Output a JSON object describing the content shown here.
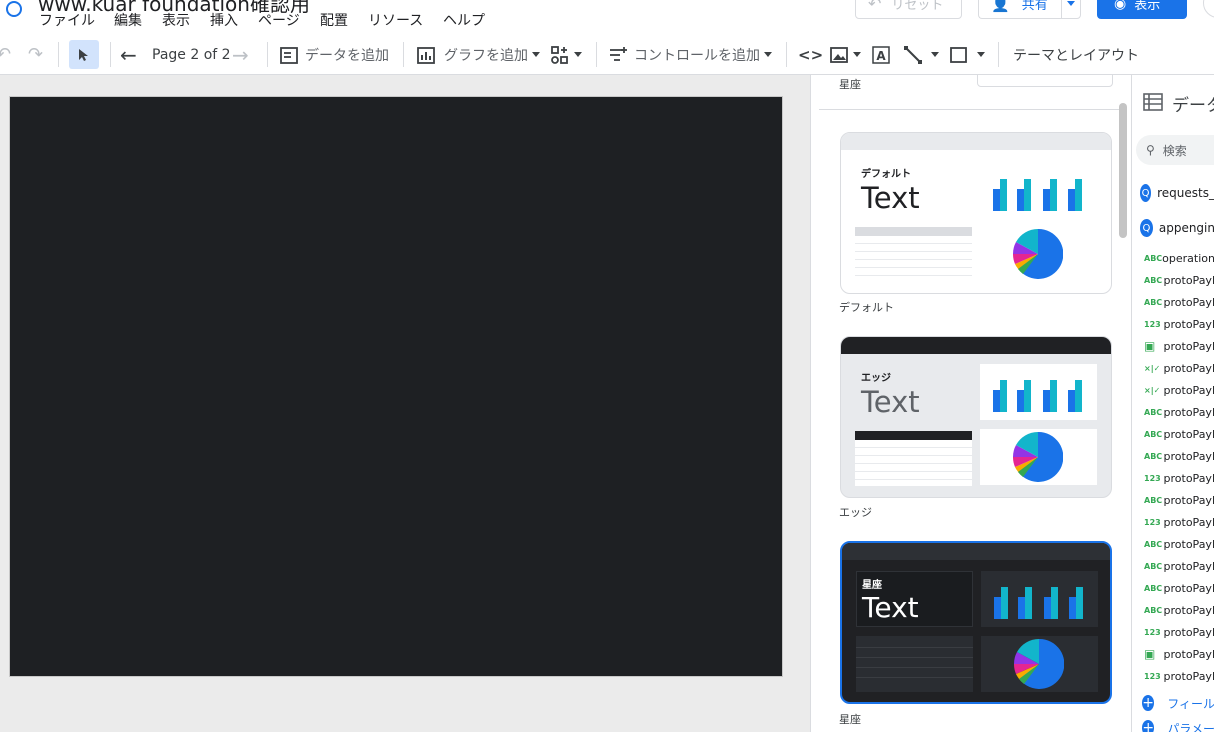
{
  "header": {
    "title": "www.kuar foundation確認用",
    "menu": [
      "ファイル",
      "編集",
      "表示",
      "挿入",
      "ページ",
      "配置",
      "リソース",
      "ヘルプ"
    ],
    "reset_label": "リセット",
    "share_label": "共有",
    "view_label": "表示"
  },
  "toolbar": {
    "page_indicator": "Page 2 of 2",
    "add_data": "データを追加",
    "add_chart": "グラフを追加",
    "add_control": "コントロールを追加",
    "theme_layout": "テーマとレイアウト"
  },
  "theme_panel": {
    "top_label": "星座",
    "themes": [
      {
        "label": "デフォルト",
        "card_title": "デフォルト",
        "card_text": "Text"
      },
      {
        "label": "エッジ",
        "card_title": "エッジ",
        "card_text": "Text"
      },
      {
        "label": "星座",
        "card_title": "星座",
        "card_text": "Text",
        "selected": true
      }
    ]
  },
  "data_panel": {
    "title": "データ",
    "search_placeholder": "検索",
    "sources": [
      "requests_",
      "appengin"
    ],
    "fields": [
      {
        "type": "ABC",
        "name": "operation"
      },
      {
        "type": "ABC",
        "name": "protoPayl"
      },
      {
        "type": "ABC",
        "name": "protoPayl"
      },
      {
        "type": "123",
        "name": "protoPayl"
      },
      {
        "type": "calendar",
        "name": "protoPayl"
      },
      {
        "type": "bool",
        "name": "protoPayl"
      },
      {
        "type": "bool",
        "name": "protoPayl"
      },
      {
        "type": "ABC",
        "name": "protoPayl"
      },
      {
        "type": "ABC",
        "name": "protoPayl"
      },
      {
        "type": "ABC",
        "name": "protoPayl"
      },
      {
        "type": "123",
        "name": "protoPayl"
      },
      {
        "type": "ABC",
        "name": "protoPayl"
      },
      {
        "type": "123",
        "name": "protoPayl"
      },
      {
        "type": "ABC",
        "name": "protoPayl"
      },
      {
        "type": "ABC",
        "name": "protoPayl"
      },
      {
        "type": "ABC",
        "name": "protoPayl"
      },
      {
        "type": "ABC",
        "name": "protoPayl"
      },
      {
        "type": "123",
        "name": "protoPayl"
      },
      {
        "type": "calendar",
        "name": "protoPayl"
      },
      {
        "type": "123",
        "name": "protoPayl"
      }
    ],
    "add_field": "フィール",
    "add_param": "パラメー"
  },
  "colors": {
    "accent": "#1a73e8",
    "canvas": "#1e2023",
    "bar_dark": "#1a73e8",
    "bar_teal": "#12b5cb"
  }
}
